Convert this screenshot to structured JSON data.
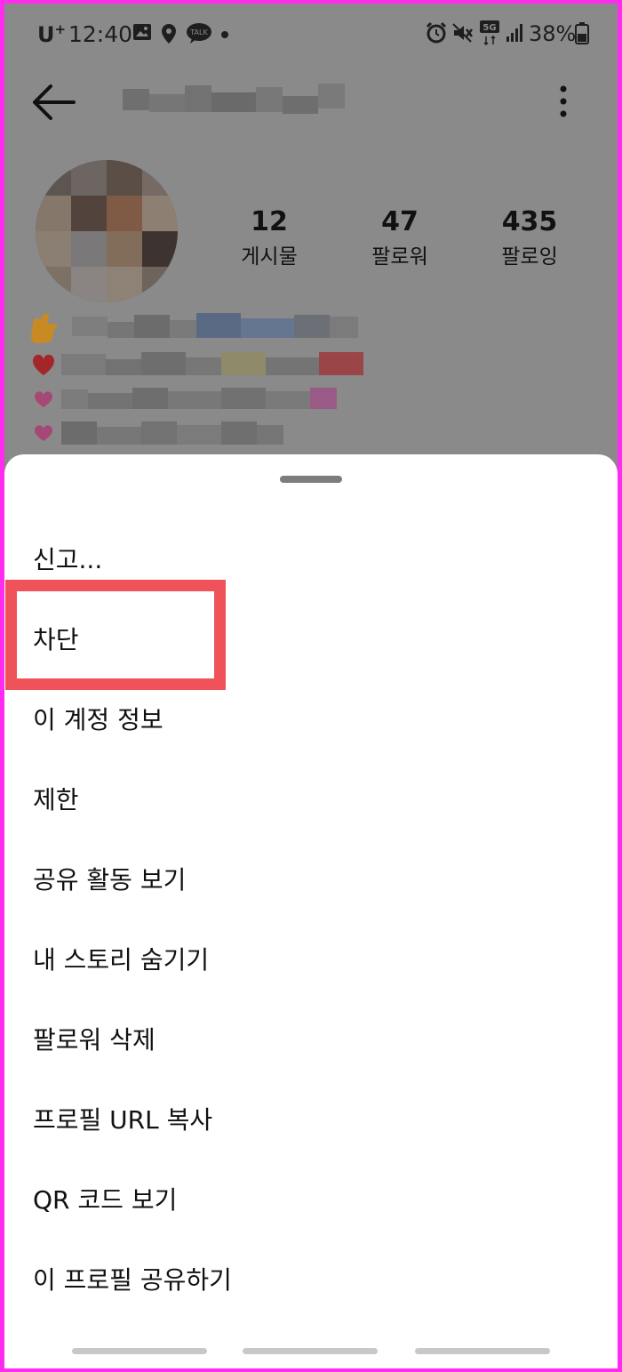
{
  "status_bar": {
    "carrier": "U",
    "carrier_sup": "+",
    "time": "12:40",
    "network": "5G",
    "battery": "38%"
  },
  "profile": {
    "stats": [
      {
        "value": "12",
        "label": "게시물"
      },
      {
        "value": "47",
        "label": "팔로워"
      },
      {
        "value": "435",
        "label": "팔로잉"
      }
    ]
  },
  "menu": {
    "items": [
      {
        "label": "신고..."
      },
      {
        "label": "차단"
      },
      {
        "label": "이 계정 정보"
      },
      {
        "label": "제한"
      },
      {
        "label": "공유 활동 보기"
      },
      {
        "label": "내 스토리 숨기기"
      },
      {
        "label": "팔로워 삭제"
      },
      {
        "label": "프로필 URL 복사"
      },
      {
        "label": "QR 코드 보기"
      },
      {
        "label": "이 프로필 공유하기"
      }
    ]
  },
  "colors": {
    "highlight": "#f0525a",
    "frame_border": "#ff2cf0",
    "dim_overlay": "#8a8a8a"
  }
}
